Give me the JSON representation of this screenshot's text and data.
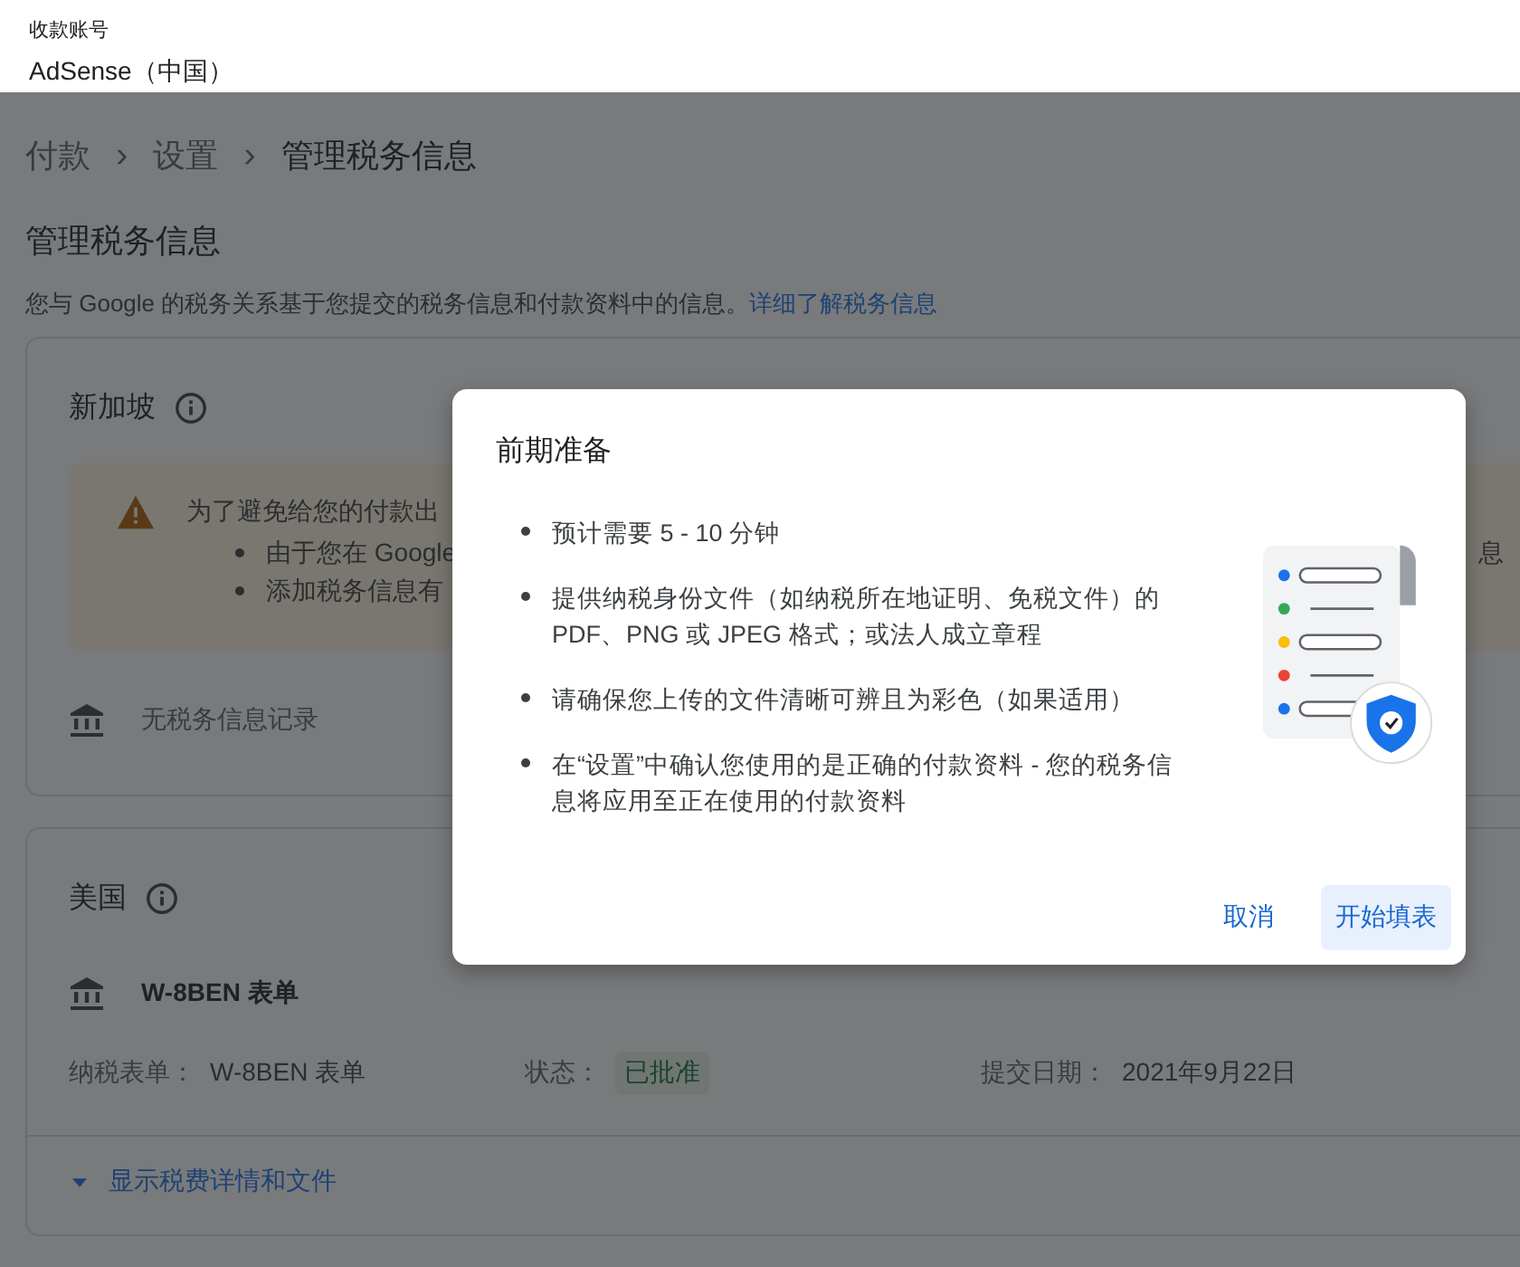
{
  "header": {
    "label": "收款账号",
    "account": "AdSense（中国）"
  },
  "breadcrumbs": [
    {
      "label": "付款"
    },
    {
      "label": "设置"
    },
    {
      "label": "管理税务信息"
    }
  ],
  "breadcrumb_separator": "›",
  "page_title": "管理税务信息",
  "description": {
    "text": "您与 Google 的税务关系基于您提交的税务信息和付款资料中的信息。",
    "link": "详细了解税务信息"
  },
  "cards": [
    {
      "kind": "pending",
      "country": "新加坡",
      "warning": {
        "title": "为了避免给您的付款出",
        "bullets": [
          "由于您在 Google",
          "添加税务信息有"
        ],
        "right_fragment": "息"
      },
      "record": "无税务信息记录"
    },
    {
      "kind": "filed",
      "country": "美国",
      "form_title": "W-8BEN 表单",
      "fields": [
        {
          "kind": "text",
          "label": "纳税表单：",
          "value": "W-8BEN 表单"
        },
        {
          "kind": "badge",
          "label": "状态：",
          "value": "已批准"
        },
        {
          "kind": "text",
          "label": "提交日期：",
          "value": "2021年9月22日"
        }
      ],
      "expander": "显示税费详情和文件"
    }
  ],
  "dialog": {
    "title": "前期准备",
    "bullets": [
      "预计需要 5 - 10 分钟",
      "提供纳税身份文件（如纳税所在地证明、免税文件）的 PDF、PNG 或 JPEG 格式；或法人成立章程",
      "请确保您上传的文件清晰可辨且为彩色（如果适用）",
      "在“设置”中确认您使用的是正确的付款资料 - 您的税务信息将应用至正在使用的付款资料"
    ],
    "buttons": [
      {
        "label": "取消",
        "kind": "text"
      },
      {
        "label": "开始填表",
        "kind": "tonal"
      }
    ]
  }
}
